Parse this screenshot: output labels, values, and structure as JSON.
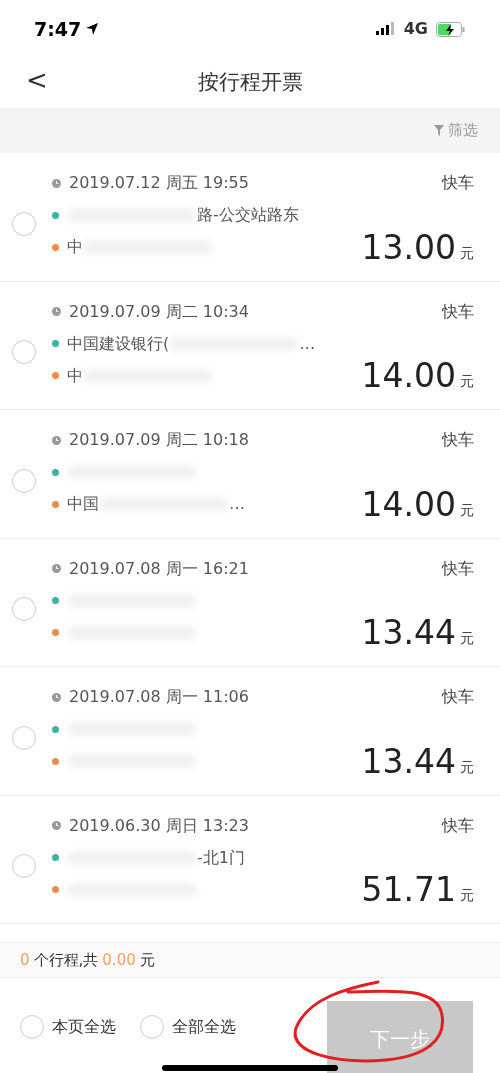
{
  "status_bar": {
    "time": "7:47",
    "network": "4G"
  },
  "header": {
    "back": "<",
    "title": "按行程开票"
  },
  "filter": {
    "label": "筛选"
  },
  "trips": [
    {
      "selected": false,
      "time": "2019.07.12 周五 19:55",
      "type": "快车",
      "from": [
        {
          "kind": "blur"
        },
        {
          "kind": "text",
          "text": "路-公交站路东"
        }
      ],
      "to": [
        {
          "kind": "text",
          "text": "中"
        },
        {
          "kind": "blur"
        }
      ],
      "amount": "13.00",
      "unit": "元"
    },
    {
      "selected": false,
      "time": "2019.07.09 周二 10:34",
      "type": "快车",
      "from": [
        {
          "kind": "text",
          "text": "中国建设银行("
        },
        {
          "kind": "blur"
        },
        {
          "kind": "text",
          "text": "…"
        }
      ],
      "to": [
        {
          "kind": "text",
          "text": "中"
        },
        {
          "kind": "blur"
        }
      ],
      "amount": "14.00",
      "unit": "元"
    },
    {
      "selected": false,
      "time": "2019.07.09 周二 10:18",
      "type": "快车",
      "from": [
        {
          "kind": "blur"
        }
      ],
      "to": [
        {
          "kind": "text",
          "text": "中国"
        },
        {
          "kind": "blur"
        },
        {
          "kind": "text",
          "text": "…"
        }
      ],
      "amount": "14.00",
      "unit": "元"
    },
    {
      "selected": false,
      "time": "2019.07.08 周一 16:21",
      "type": "快车",
      "from": [
        {
          "kind": "blur"
        }
      ],
      "to": [
        {
          "kind": "blur"
        }
      ],
      "amount": "13.44",
      "unit": "元"
    },
    {
      "selected": false,
      "time": "2019.07.08 周一 11:06",
      "type": "快车",
      "from": [
        {
          "kind": "blur"
        }
      ],
      "to": [
        {
          "kind": "blur"
        }
      ],
      "amount": "13.44",
      "unit": "元"
    },
    {
      "selected": false,
      "time": "2019.06.30 周日 13:23",
      "type": "快车",
      "from": [
        {
          "kind": "blur"
        },
        {
          "kind": "text",
          "text": "-北1门"
        }
      ],
      "to": [
        {
          "kind": "blur"
        }
      ],
      "amount": "51.71",
      "unit": "元"
    }
  ],
  "summary": {
    "count": "0",
    "count_label": "个行程,共",
    "total": "0.00",
    "unit": "元"
  },
  "footer": {
    "options": [
      {
        "label": "本页全选",
        "checked": false
      },
      {
        "label": "全部全选",
        "checked": false
      }
    ],
    "next_button": {
      "label": "下一步",
      "disabled": true
    }
  }
}
